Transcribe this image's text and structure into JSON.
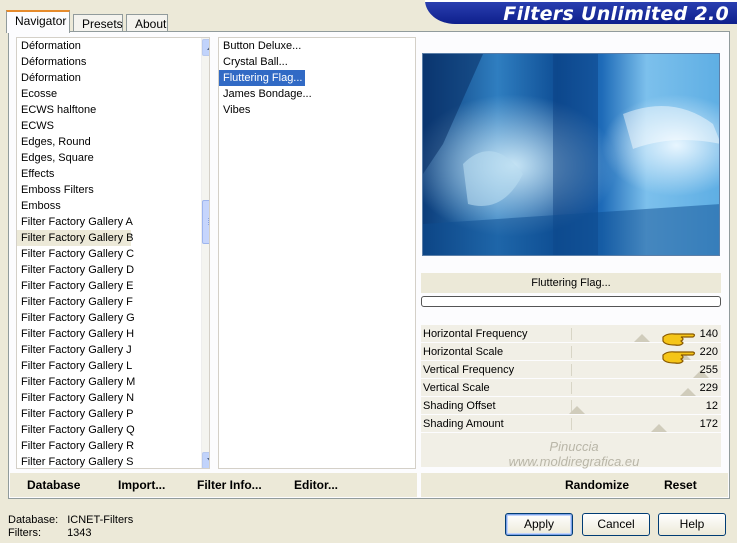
{
  "tabs": [
    {
      "label": "Navigator",
      "active": true
    },
    {
      "label": "Presets",
      "active": false
    },
    {
      "label": "About",
      "active": false
    }
  ],
  "banner": {
    "title": "Filters Unlimited 2.0"
  },
  "categories": [
    "Déformation",
    "Déformations",
    "Déformation",
    "Ecosse",
    "ECWS halftone",
    "ECWS",
    "Edges, Round",
    "Edges, Square",
    "Effects",
    "Emboss Filters",
    "Emboss",
    "Filter Factory Gallery A",
    "Filter Factory Gallery B",
    "Filter Factory Gallery C",
    "Filter Factory Gallery D",
    "Filter Factory Gallery E",
    "Filter Factory Gallery F",
    "Filter Factory Gallery G",
    "Filter Factory Gallery H",
    "Filter Factory Gallery J",
    "Filter Factory Gallery L",
    "Filter Factory Gallery M",
    "Filter Factory Gallery N",
    "Filter Factory Gallery P",
    "Filter Factory Gallery Q",
    "Filter Factory Gallery R",
    "Filter Factory Gallery S"
  ],
  "selected_category": "Filter Factory Gallery B",
  "filters": [
    "Button Deluxe...",
    "Crystal Ball...",
    "Fluttering Flag...",
    "James Bondage...",
    "Vibes"
  ],
  "selected_filter": "Fluttering Flag...",
  "preview": {
    "filter_name": "Fluttering Flag..."
  },
  "parameters": [
    {
      "label": "Horizontal Frequency",
      "value": "140",
      "level": 0.549
    },
    {
      "label": "Horizontal Scale",
      "value": "220",
      "level": 0.863
    },
    {
      "label": "Vertical Frequency",
      "value": "255",
      "level": 1.0
    },
    {
      "label": "Vertical Scale",
      "value": "229",
      "level": 0.898
    },
    {
      "label": "Shading Offset",
      "value": "12",
      "level": 0.047
    },
    {
      "label": "Shading Amount",
      "value": "172",
      "level": 0.675
    }
  ],
  "watermark": {
    "line1": "Pinuccia",
    "line2": "www.moldiregrafica.eu"
  },
  "bottom_buttons": {
    "database": "Database",
    "import": "Import...",
    "filter_info": "Filter Info...",
    "editor": "Editor...",
    "randomize": "Randomize",
    "reset": "Reset"
  },
  "status": {
    "database_label": "Database:",
    "database_value": "ICNET-Filters",
    "filters_label": "Filters:",
    "filters_value": "1343"
  },
  "dialog_buttons": {
    "apply": "Apply",
    "cancel": "Cancel",
    "help": "Help"
  },
  "colors": {
    "selection": "#316ac5",
    "banner": "#1a2ea0",
    "tab_highlight": "#e68b2c"
  }
}
